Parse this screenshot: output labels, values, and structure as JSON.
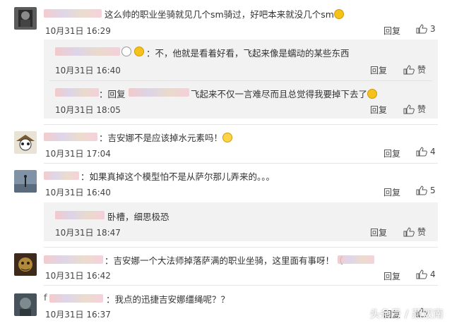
{
  "comments": [
    {
      "text": "这么帅的职业坐骑就见几个sm骑过，好吧本来就没几个sm",
      "time": "10月31日 16:29",
      "reply_label": "回复",
      "likes": "3",
      "replies": [
        {
          "text": "：不，他就是看着好看，飞起来像是蠕动的某些东西",
          "time": "10月31日 16:40",
          "reply_label": "回复",
          "likes": "赞"
        },
        {
          "text": "：回复",
          "text2": "飞起来不仅一言难尽而且总觉得我要掉下去了",
          "time": "10月31日 18:05",
          "reply_label": "回复",
          "likes": "赞"
        }
      ]
    },
    {
      "text": "：吉安娜不是应该掉水元素吗！",
      "time": "10月31日 17:04",
      "reply_label": "回复",
      "likes": "4",
      "replies": []
    },
    {
      "text": "：如果真掉这个模型怕不是从萨尔那儿弄来的。。。",
      "time": "10月31日 16:40",
      "reply_label": "回复",
      "likes": "5",
      "replies": [
        {
          "text": "卧槽，细思极恐",
          "time": "10月31日 18:47",
          "reply_label": "回复",
          "likes": "赞"
        }
      ]
    },
    {
      "text": "：吉安娜一个大法师掉落萨满的职业坐骑，这里面有事呀！（",
      "time": "10月31日 16:42",
      "reply_label": "回复",
      "likes": "4",
      "replies": []
    },
    {
      "text": "：我点的迅捷吉安娜缰绳呢？？",
      "name_prefix": "f",
      "time": "10月31日 16:37",
      "reply_label": "回复",
      "likes": "",
      "replies": []
    }
  ],
  "watermark": "头条号 / 燕双南",
  "icons": {
    "like": "thumbs-up-icon"
  }
}
